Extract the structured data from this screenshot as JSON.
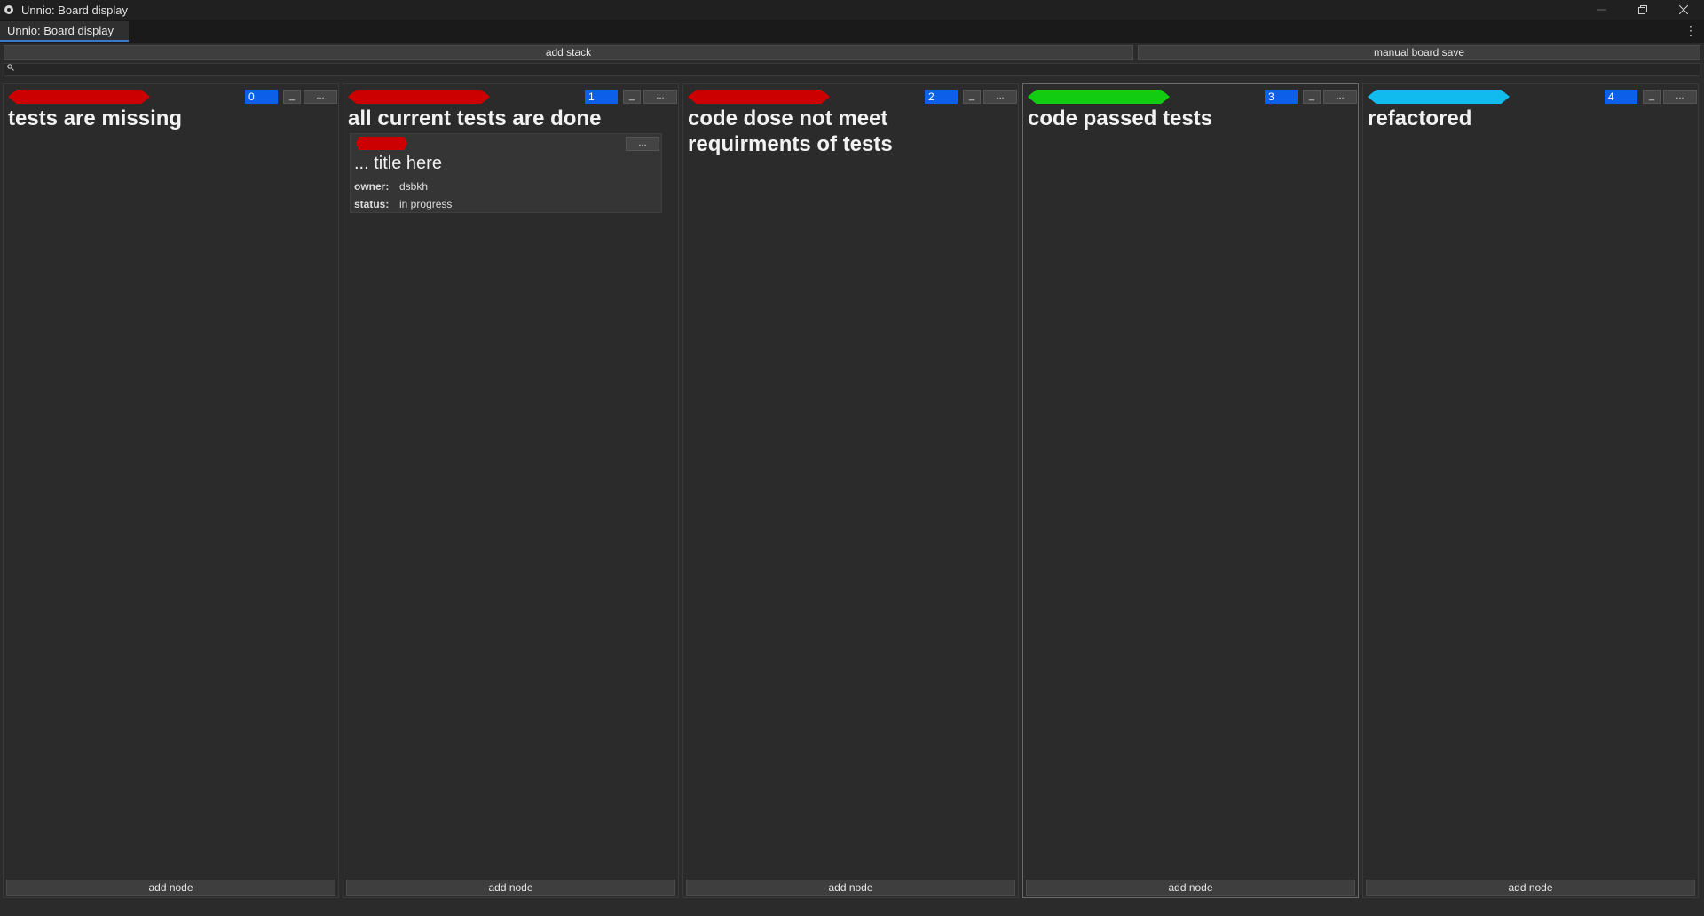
{
  "window": {
    "title": "Unnio: Board display"
  },
  "tabs": [
    {
      "label": "Unnio: Board display"
    }
  ],
  "toolbar": {
    "add_stack_label": "add stack",
    "manual_save_label": "manual board save"
  },
  "search": {
    "placeholder": ""
  },
  "stacks": [
    {
      "title": "tests are missing",
      "count": "0",
      "tag_color": "#cc0000",
      "minimize_label": "_",
      "menu_label": "...",
      "add_node_label": "add node"
    },
    {
      "title": "all current tests are done",
      "count": "1",
      "tag_color": "#cc0000",
      "minimize_label": "_",
      "menu_label": "...",
      "add_node_label": "add node",
      "nodes": [
        {
          "title": "... title here",
          "tag_color": "#cc0000",
          "menu_label": "...",
          "owner_key": "owner:",
          "owner": "dsbkh",
          "status_key": "status:",
          "status": "in progress"
        }
      ]
    },
    {
      "title": "code dose not meet requirments of tests",
      "count": "2",
      "tag_color": "#cc0000",
      "minimize_label": "_",
      "menu_label": "...",
      "add_node_label": "add node"
    },
    {
      "title": "code passed tests",
      "count": "3",
      "tag_color": "#11cc11",
      "minimize_label": "_",
      "menu_label": "...",
      "add_node_label": "add node"
    },
    {
      "title": "refactored",
      "count": "4",
      "tag_color": "#11bbee",
      "minimize_label": "_",
      "menu_label": "...",
      "add_node_label": "add node"
    }
  ]
}
